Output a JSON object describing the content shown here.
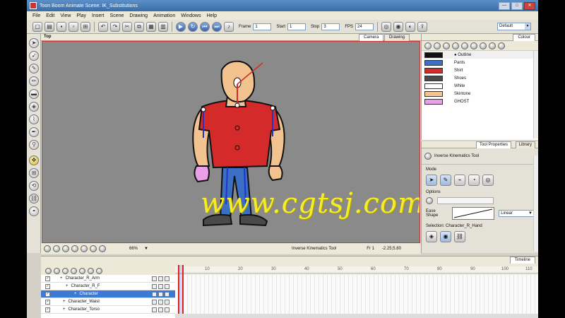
{
  "window": {
    "title": "Toon Boom Animate Scene: IK_Substitutions",
    "minimize": "—",
    "maximize": "□",
    "close": "✕"
  },
  "menu": [
    "File",
    "Edit",
    "View",
    "Play",
    "Insert",
    "Scene",
    "Drawing",
    "Animation",
    "Windows",
    "Help"
  ],
  "toolbar": {
    "frame_label": "Frame",
    "frame_value": "1",
    "start_label": "Start",
    "start_value": "1",
    "stop_label": "Stop",
    "stop_value": "3",
    "fps_label": "FPS",
    "fps_value": "24",
    "workspace": "Default"
  },
  "viewport": {
    "view_name": "Top",
    "tabs": [
      "Camera",
      "Drawing"
    ],
    "zoom": "66%",
    "status_tool": "Inverse Kinematics Tool",
    "frame_readout": "Fr 1",
    "coords": "-2.25;5.80"
  },
  "colour_panel": {
    "tab": "Colour",
    "swatches": [
      {
        "name": "Outline",
        "color": "#111111",
        "current": true
      },
      {
        "name": "Pants",
        "color": "#3a6fc4"
      },
      {
        "name": "Shirt",
        "color": "#d42a2a"
      },
      {
        "name": "Shoes",
        "color": "#4a4a4a"
      },
      {
        "name": "White",
        "color": "#ffffff"
      },
      {
        "name": "Skintone",
        "color": "#f2c28f"
      },
      {
        "name": "GHOST",
        "color": "#e9a0e9"
      }
    ]
  },
  "tool_properties": {
    "tabs": [
      "Tool Properties",
      "Library"
    ],
    "tool_name": "Inverse Kinematics Tool",
    "mode_label": "Mode",
    "options_label": "Options",
    "ease_label": "Ease Shape",
    "ease_value": "Linear",
    "selection_label": "Selection: Character_R_Hand"
  },
  "timeline": {
    "tab": "Timeline",
    "ticks": [
      "10",
      "20",
      "30",
      "40",
      "50",
      "60",
      "70",
      "80",
      "90",
      "100",
      "110"
    ],
    "layers": [
      {
        "name": "Character_R_Arm",
        "checked": true,
        "selected": false
      },
      {
        "name": "Character_R_F",
        "checked": true,
        "selected": false
      },
      {
        "name": "Character",
        "checked": true,
        "selected": true
      },
      {
        "name": "Character_Waist",
        "checked": true,
        "selected": false
      },
      {
        "name": "Character_Torso",
        "checked": true,
        "selected": false
      }
    ]
  },
  "watermark": "www.cgtsj.com"
}
